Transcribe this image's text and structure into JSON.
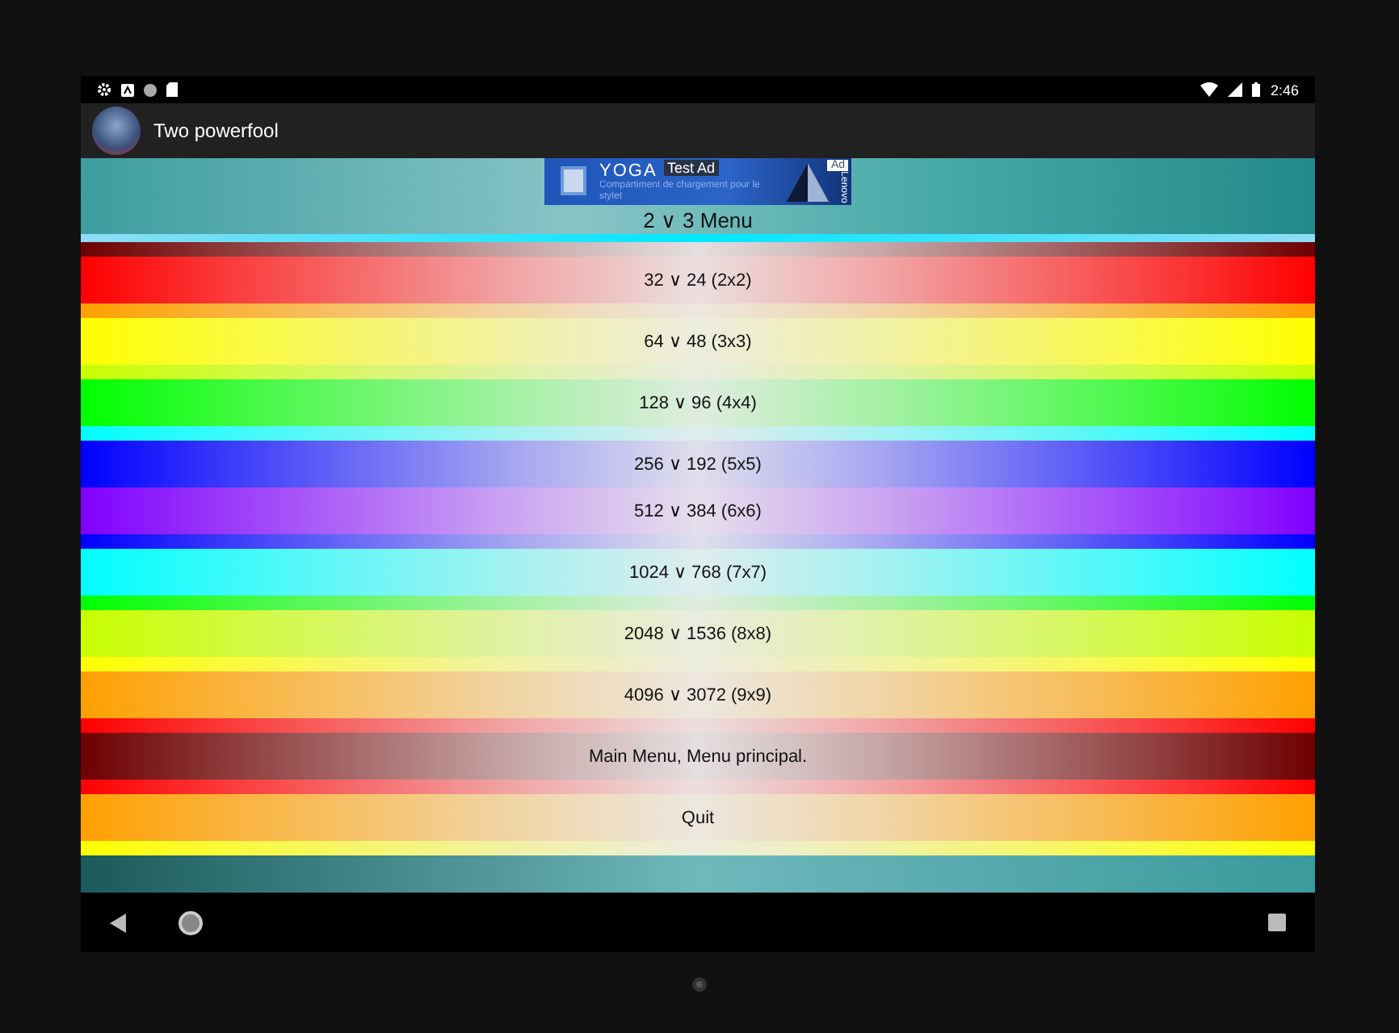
{
  "status_bar": {
    "time": "2:46"
  },
  "app_bar": {
    "title": "Two powerfool"
  },
  "ad": {
    "brand": "YOGA",
    "label": "Test Ad",
    "badge": "Ad",
    "tagline": "Compartiment de chargement pour le stylet",
    "maker": "Lenovo"
  },
  "menu": {
    "title": "2 ∨ 3 Menu",
    "items": [
      {
        "kind": "strip",
        "color": "#6e0000"
      },
      {
        "kind": "button",
        "label": "32 ∨ 24 (2x2)",
        "color": "#ff0000"
      },
      {
        "kind": "strip",
        "color": "#ffa000"
      },
      {
        "kind": "button",
        "label": "64 ∨ 48 (3x3)",
        "color": "#ffff00"
      },
      {
        "kind": "strip",
        "color": "#c8ff00"
      },
      {
        "kind": "button",
        "label": "128 ∨ 96 (4x4)",
        "color": "#00ff00"
      },
      {
        "kind": "strip",
        "color": "#00ffff"
      },
      {
        "kind": "button",
        "label": "256 ∨ 192 (5x5)",
        "color": "#0000ff"
      },
      {
        "kind": "button",
        "label": "512 ∨ 384 (6x6)",
        "color": "#8000ff"
      },
      {
        "kind": "strip",
        "color": "#0000ff"
      },
      {
        "kind": "button",
        "label": "1024 ∨ 768 (7x7)",
        "color": "#00ffff"
      },
      {
        "kind": "strip",
        "color": "#00ff00"
      },
      {
        "kind": "button",
        "label": "2048 ∨ 1536 (8x8)",
        "color": "#c8ff00"
      },
      {
        "kind": "strip",
        "color": "#ffff00"
      },
      {
        "kind": "button",
        "label": "4096 ∨ 3072 (9x9)",
        "color": "#ffa000"
      },
      {
        "kind": "strip",
        "color": "#ff0000"
      },
      {
        "kind": "button",
        "label": "Main Menu, Menu principal.",
        "color": "#6e0000"
      },
      {
        "kind": "strip",
        "color": "#ff0000"
      },
      {
        "kind": "button",
        "label": "Quit",
        "color": "#ffa000"
      },
      {
        "kind": "strip",
        "color": "#ffff00"
      }
    ]
  }
}
